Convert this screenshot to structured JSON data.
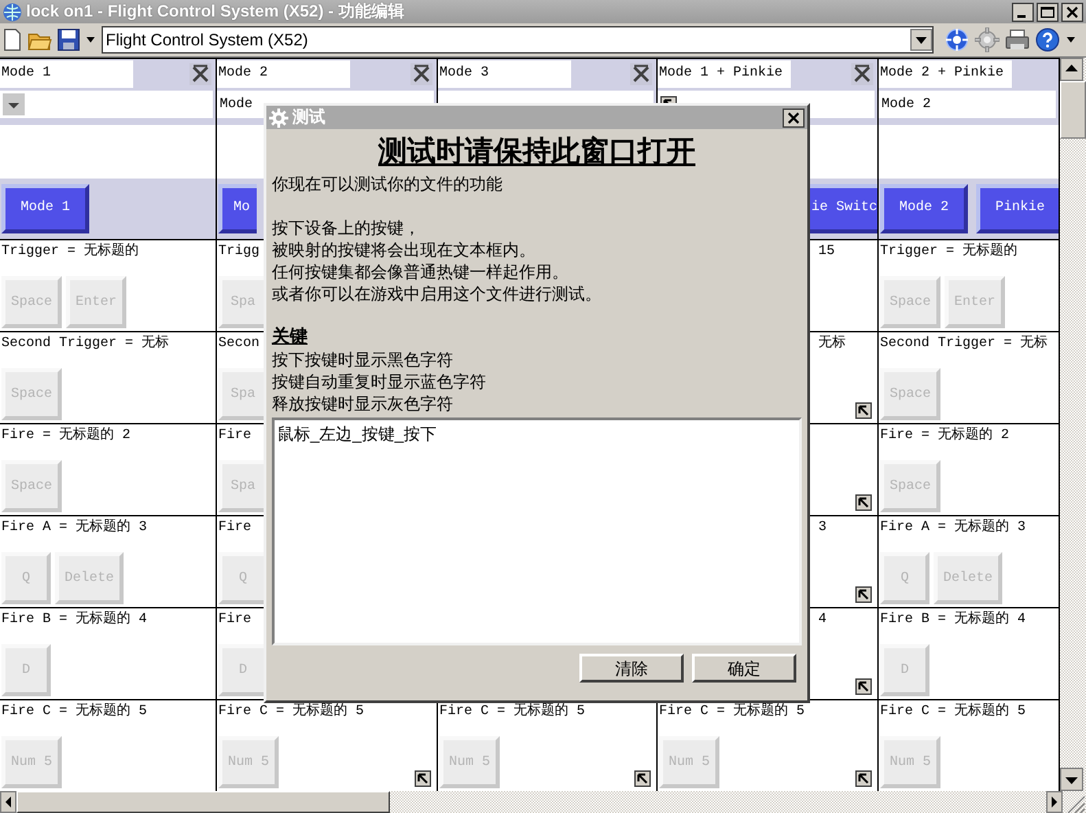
{
  "window": {
    "title": "lock on1 - Flight Control System (X52) - 功能编辑"
  },
  "toolbar": {
    "profile": "Flight Control System (X52)"
  },
  "columns": [
    {
      "kind": "full",
      "name": "Mode 1",
      "closable": true,
      "mode_dropdown": true,
      "mode_linked": false,
      "mode_buttons": [
        "Mode 1"
      ],
      "rows": [
        {
          "label": "Trigger = 无标题的",
          "keys": [
            "Space",
            "Enter"
          ],
          "linked": false
        },
        {
          "label": "Second Trigger = 无标",
          "keys": [
            "Space"
          ],
          "linked": false
        },
        {
          "label": "Fire = 无标题的 2",
          "keys": [
            "Space"
          ],
          "linked": false
        },
        {
          "label": "Fire A = 无标题的 3",
          "keys": [
            "Q",
            "Delete"
          ],
          "linked": false
        },
        {
          "label": "Fire B = 无标题的 4",
          "keys": [
            "D"
          ],
          "linked": false
        },
        {
          "label": "Fire C = 无标题的 5",
          "keys": [
            "Num 5"
          ],
          "linked": false
        }
      ]
    },
    {
      "kind": "left_part",
      "name": "Mode 2",
      "closable": true,
      "mode": "Mode",
      "mode_buttons": [
        "Mo"
      ],
      "rows": [
        {
          "label": "Trigg",
          "keys": [
            "Spa"
          ],
          "linked": false
        },
        {
          "label": "Secon",
          "keys": [
            "Spa"
          ],
          "linked": false
        },
        {
          "label": "Fire",
          "keys": [
            "Spa"
          ],
          "linked": false
        },
        {
          "label": "Fire",
          "keys": [
            "Q"
          ],
          "linked": false
        },
        {
          "label": "Fire",
          "keys": [
            "D"
          ],
          "linked": false
        },
        {
          "label": "Fire C = 无标题的 5",
          "keys": [
            "Num 5"
          ],
          "linked": true
        }
      ]
    },
    {
      "kind": "full",
      "name": "Mode 3",
      "closable": true,
      "rows": [
        {},
        {},
        {},
        {},
        {},
        {
          "label": "Fire C = 无标题的 5",
          "keys": [
            "Num 5"
          ],
          "linked": true
        }
      ]
    },
    {
      "kind": "right_part",
      "name": "Mode 1 + Pinkie",
      "closable": true,
      "mode_dropdown": false,
      "mode_linked": true,
      "mode_buttons": [
        "ie Switc"
      ],
      "rows": [
        {
          "kind": "tail",
          "label": "15",
          "linked": false
        },
        {
          "kind": "tail",
          "label": "无标",
          "linked": true
        },
        {
          "kind": "tail",
          "linked": true
        },
        {
          "kind": "tail",
          "label": "3",
          "linked": true
        },
        {
          "kind": "tail",
          "label": "4",
          "linked": true
        },
        {
          "kind": "full",
          "label": "Fire C = 无标题的 5",
          "keys": [
            "Num 5"
          ],
          "linked": true
        }
      ]
    },
    {
      "kind": "full",
      "name": "Mode 2 + Pinkie",
      "closable": false,
      "mode_dropdown": false,
      "mode_linked": false,
      "mode": "Mode 2",
      "mode_buttons": [
        "Mode 2",
        "Pinkie"
      ],
      "rows": [
        {
          "label": "Trigger = 无标题的",
          "keys": [
            "Space",
            "Enter"
          ],
          "linked": false
        },
        {
          "label": "Second Trigger = 无标",
          "keys": [
            "Space"
          ],
          "linked": false
        },
        {
          "label": "Fire = 无标题的 2",
          "keys": [
            "Space"
          ],
          "linked": false
        },
        {
          "label": "Fire A = 无标题的 3",
          "keys": [
            "Q",
            "Delete"
          ],
          "linked": false
        },
        {
          "label": "Fire B = 无标题的 4",
          "keys": [
            "D"
          ],
          "linked": false
        },
        {
          "label": "Fire C = 无标题的 5",
          "keys": [
            "Num 5"
          ],
          "linked": false
        }
      ]
    }
  ],
  "dialog": {
    "title": "测试",
    "heading": "测试时请保持此窗口打开",
    "intro": "你现在可以测试你的文件的功能",
    "lines": [
      "按下设备上的按键，",
      "被映射的按键将会出现在文本框内。",
      "任何按键集都会像普通热键一样起作用。",
      "或者你可以在游戏中启用这个文件进行测试。"
    ],
    "legend_title": "关键",
    "legend": [
      "按下按键时显示黑色字符",
      "按键自动重复时显示蓝色字符",
      "释放按键时显示灰色字符"
    ],
    "log": "鼠标_左边_按键_按下",
    "buttons": [
      "清除",
      "确定"
    ]
  }
}
